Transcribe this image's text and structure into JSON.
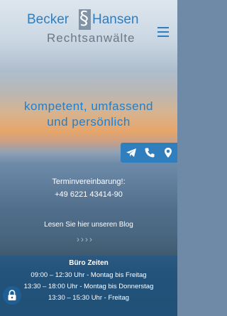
{
  "header": {
    "logo": {
      "word1": "Becker",
      "mark": "§",
      "word2": "Hansen",
      "subtitle": "Rechtsanwälte"
    },
    "menu_icon": "hamburger-menu-icon"
  },
  "hero": {
    "tagline_line1": "kompetent, umfassend",
    "tagline_line2": "und persönlich"
  },
  "actions": {
    "icons": [
      "send-icon",
      "phone-icon",
      "location-pin-icon"
    ]
  },
  "contact": {
    "label": "Terminvereinbarung!:",
    "phone": "+49 6221 43414-90"
  },
  "blog": {
    "link_text": "Lesen Sie hier unseren Blog",
    "arrows": "››››"
  },
  "office_hours": {
    "title": "Büro Zeiten",
    "rows": [
      "09:00 – 12:30 Uhr - Montag bis Freitag",
      "13:30 – 18:00 Uhr - Montag bis Donnerstag",
      "13:30 – 15:30 Uhr - Freitag"
    ]
  },
  "colors": {
    "brand_blue": "#2f7fbf",
    "tagline_blue": "#1f7fd0"
  }
}
